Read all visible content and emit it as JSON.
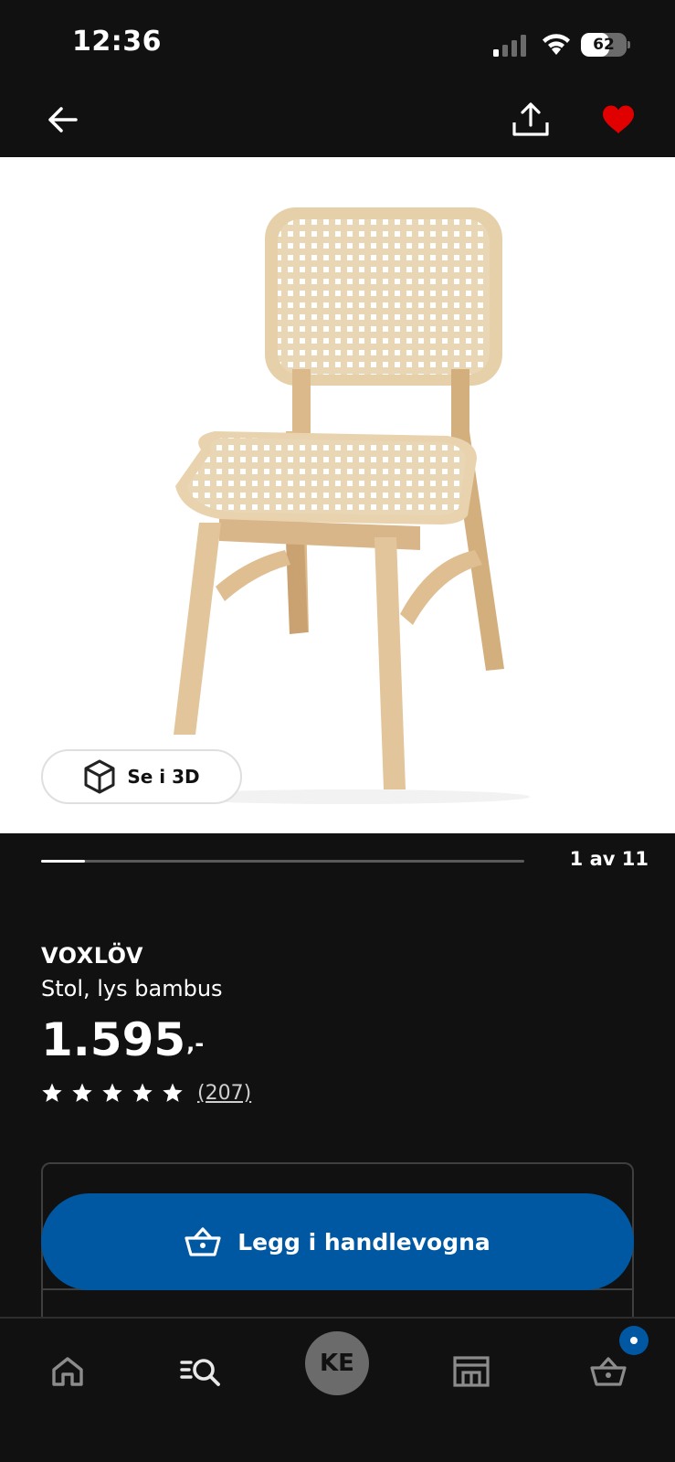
{
  "status_bar": {
    "time": "12:36",
    "battery_level": "62",
    "battery_percent": 62
  },
  "nav": {
    "back_icon": "arrow-left-icon",
    "share_icon": "share-icon",
    "favorite_icon": "heart-icon",
    "favorite_color": "#e00000"
  },
  "gallery": {
    "view_3d_label": "Se i 3D",
    "view_3d_icon": "cube-icon",
    "position_text": "1 av 11",
    "current": 1,
    "total": 11
  },
  "product": {
    "name": "VOXLÖV",
    "description": "Stol, lys bambus",
    "price": "1.595",
    "price_suffix": ",-",
    "rating_stars": 5,
    "rating_count": "(207)"
  },
  "cart_button": {
    "label": "Legg i handlevogna",
    "icon": "basket-icon",
    "color": "#0058a3"
  },
  "bottom_nav": {
    "items": [
      {
        "icon": "home-icon"
      },
      {
        "icon": "search-icon"
      },
      {
        "label": "KE"
      },
      {
        "icon": "store-icon"
      },
      {
        "icon": "basket-icon"
      }
    ]
  }
}
